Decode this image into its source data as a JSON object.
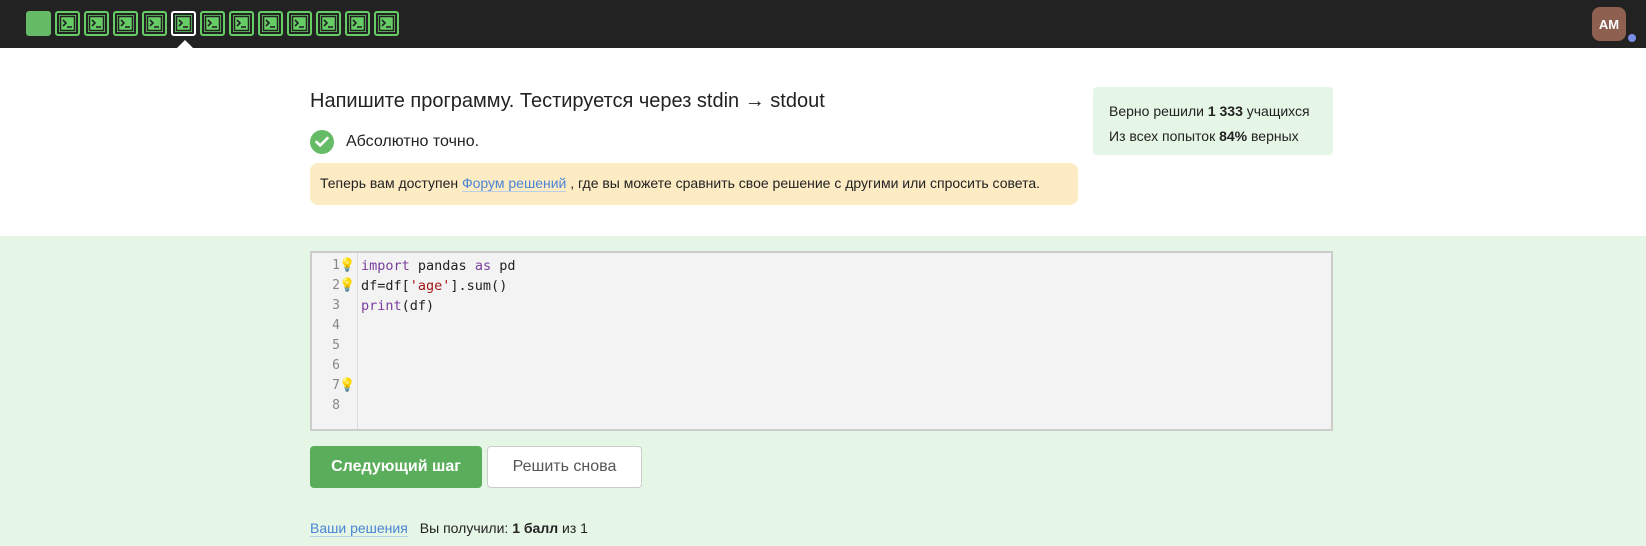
{
  "topbar": {
    "steps": [
      {
        "type": "text",
        "state": "done"
      },
      {
        "type": "code",
        "state": "done"
      },
      {
        "type": "code",
        "state": "done"
      },
      {
        "type": "code",
        "state": "done"
      },
      {
        "type": "code",
        "state": "done"
      },
      {
        "type": "code",
        "state": "current"
      },
      {
        "type": "code",
        "state": "done"
      },
      {
        "type": "code",
        "state": "done"
      },
      {
        "type": "code",
        "state": "done"
      },
      {
        "type": "code",
        "state": "done"
      },
      {
        "type": "code",
        "state": "done"
      },
      {
        "type": "code",
        "state": "done"
      },
      {
        "type": "code",
        "state": "done"
      }
    ],
    "avatar_initials": "AM"
  },
  "task": {
    "title": "Напишите программу. Тестируется через stdin → stdout",
    "result_text": "Абсолютно точно.",
    "notice_prefix": "Теперь вам доступен ",
    "notice_link": "Форум решений",
    "notice_suffix": " , где вы можете сравнить свое решение с другими или спросить совета."
  },
  "stats": {
    "line1_prefix": "Верно решили ",
    "line1_count": "1 333",
    "line1_suffix": " учащихся",
    "line2_prefix": "Из всех попыток ",
    "line2_percent": "84%",
    "line2_suffix": " верных"
  },
  "editor": {
    "line_numbers": [
      "1",
      "2",
      "3",
      "4",
      "5",
      "6",
      "7",
      "8"
    ],
    "hint_lines": [
      1,
      2,
      7
    ],
    "lines": [
      "import pandas as pd",
      "df=df['age'].sum()",
      "print(df)",
      "",
      "",
      "",
      "",
      ""
    ]
  },
  "buttons": {
    "next_label": "Следующий шаг",
    "retry_label": "Решить снова"
  },
  "footer": {
    "solutions_link": "Ваши решения",
    "score_prefix": "Вы получили: ",
    "score_value": "1 балл",
    "score_suffix": " из 1"
  },
  "colors": {
    "topbar_bg": "#222222",
    "step_green": "#66cc66",
    "accent_green": "#5aad5a",
    "notice_bg": "#fdebc4",
    "stats_bg": "#e6f6e6",
    "link": "#4a84d4",
    "avatar_bg": "#8d6050"
  }
}
